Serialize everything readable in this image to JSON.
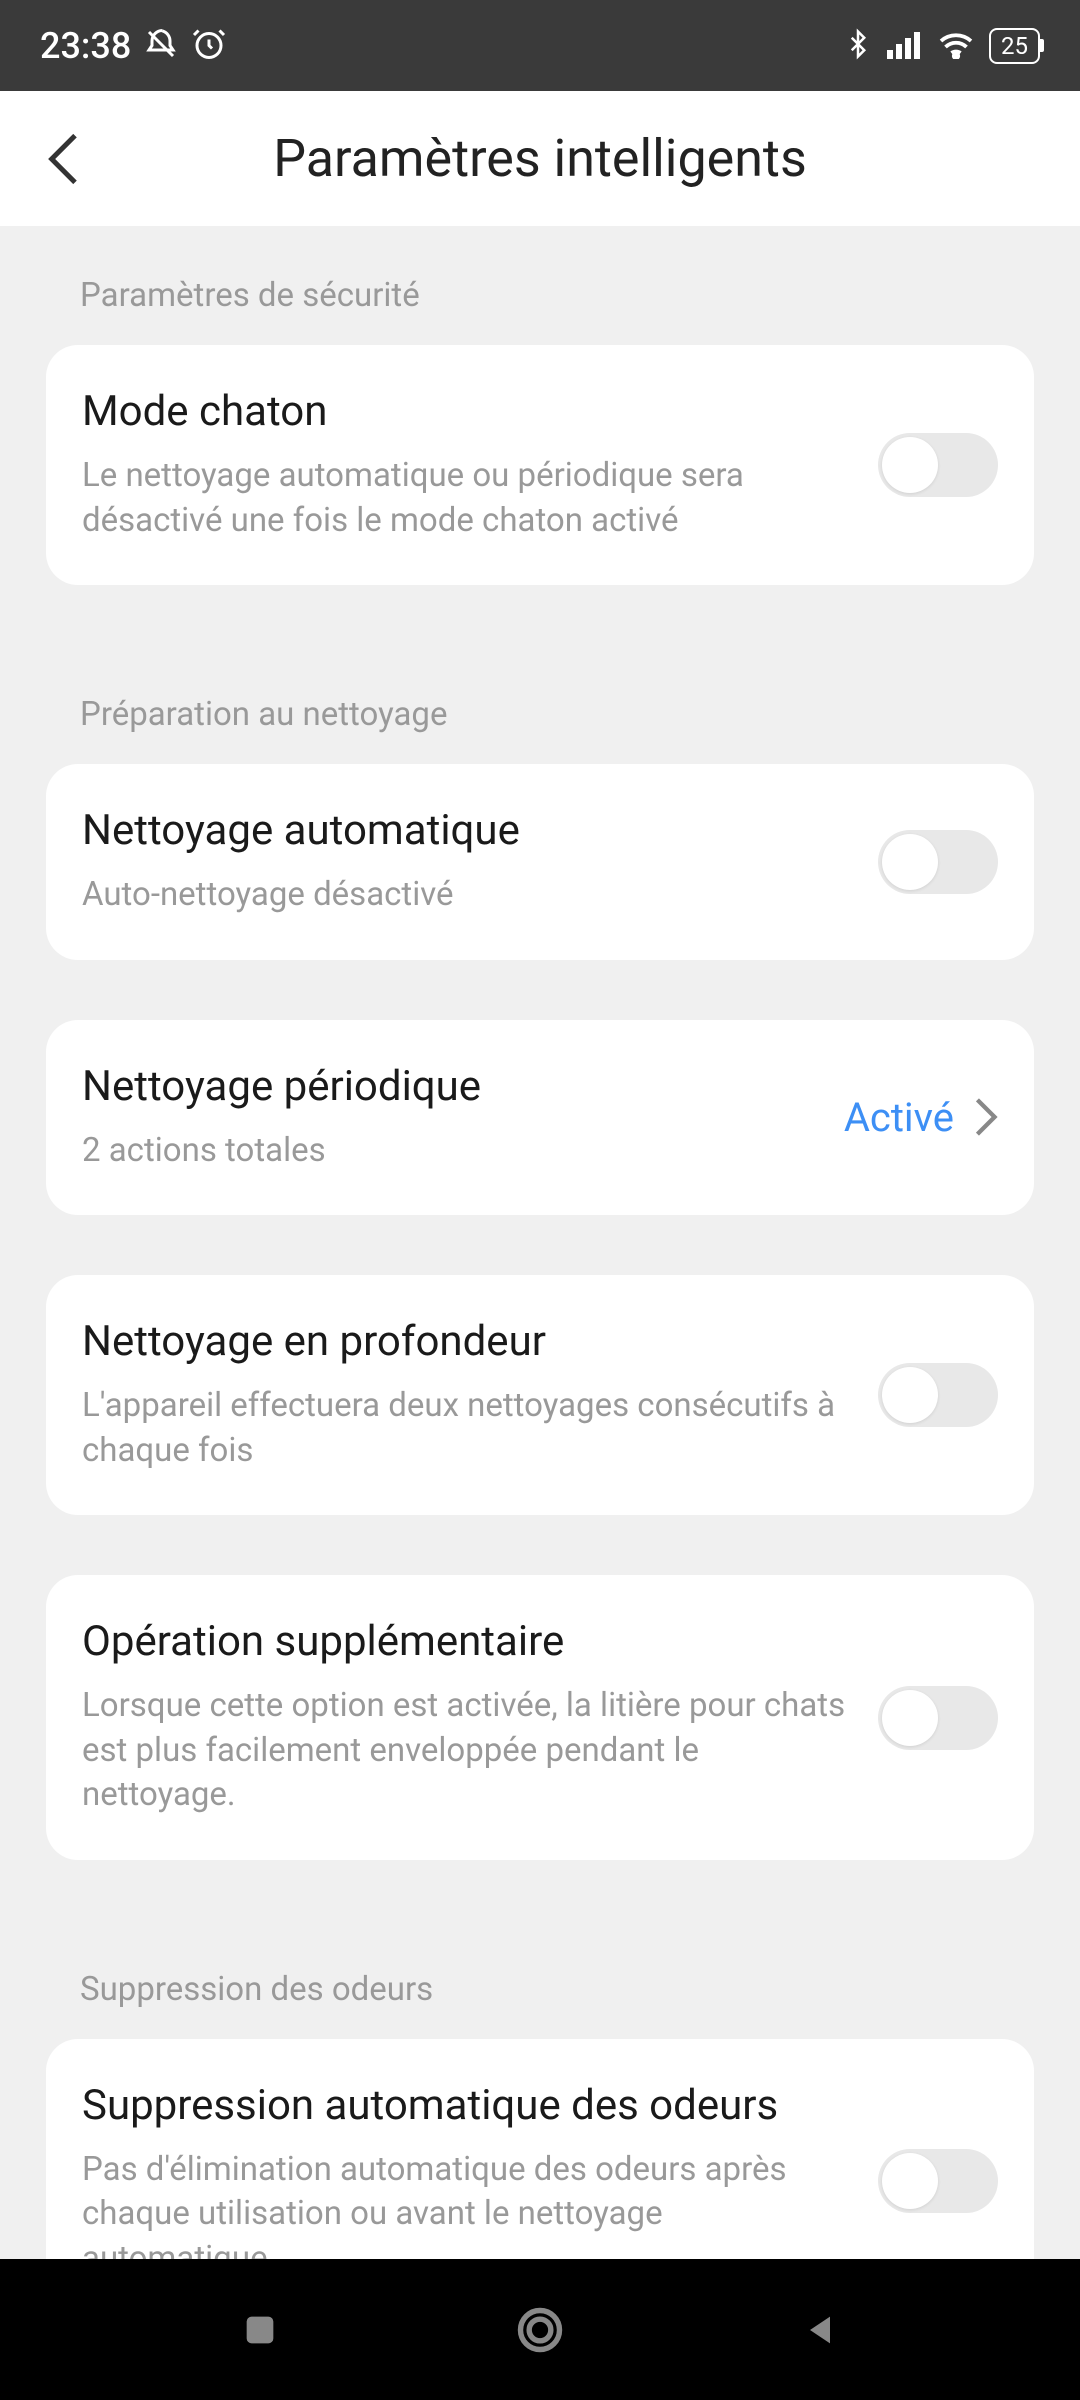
{
  "status": {
    "time": "23:38",
    "battery": "25"
  },
  "header": {
    "title": "Paramètres intelligents"
  },
  "sections": {
    "security": {
      "label": "Paramètres de sécurité",
      "kitten_mode": {
        "title": "Mode chaton",
        "desc": "Le nettoyage automatique ou périodique sera désactivé une fois le mode chaton activé"
      }
    },
    "cleaning_prep": {
      "label": "Préparation au nettoyage",
      "auto_clean": {
        "title": "Nettoyage automatique",
        "desc": "Auto-nettoyage désactivé"
      },
      "periodic_clean": {
        "title": "Nettoyage périodique",
        "desc": "2 actions totales",
        "status": "Activé"
      },
      "deep_clean": {
        "title": "Nettoyage en profondeur",
        "desc": "L'appareil effectuera deux nettoyages consécutifs à chaque fois"
      },
      "extra_op": {
        "title": "Opération supplémentaire",
        "desc": "Lorsque cette option est activée, la litière pour chats est plus facilement enveloppée pendant le nettoyage."
      }
    },
    "odor": {
      "label": "Suppression des odeurs",
      "auto_odor": {
        "title": "Suppression automatique des odeurs",
        "desc": "Pas d'élimination automatique des odeurs après chaque utilisation ou avant le nettoyage automatique."
      }
    }
  }
}
